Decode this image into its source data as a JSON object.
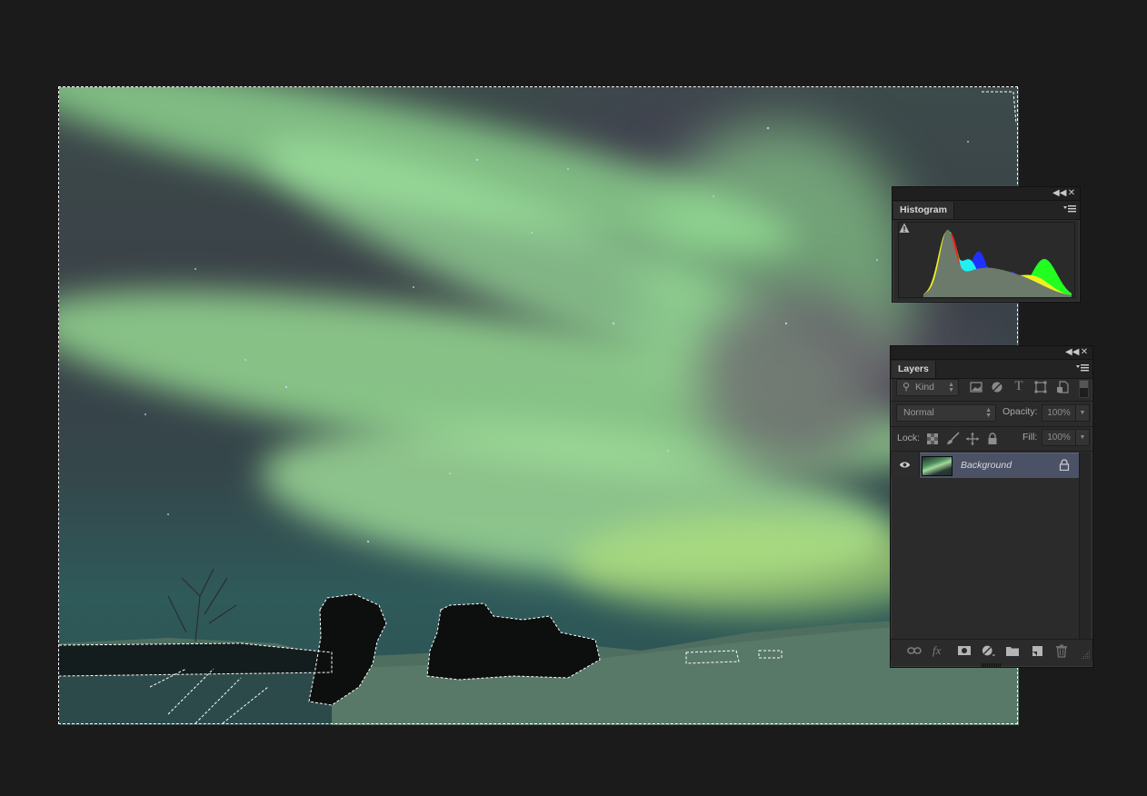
{
  "document": {
    "image_subject": "aurora borealis over snowy landscape with rock formations",
    "selection": "active marching-ants selection",
    "colors": {
      "workspace_bg": "#1b1b1b",
      "aurora_green": "#9fe0a3",
      "sky_dark": "#3a4148",
      "selection": "#ffffff"
    }
  },
  "histogram_panel": {
    "tab_label": "Histogram",
    "collapse_icon": "double-chevron-left-icon",
    "close_icon": "close-icon",
    "menu_icon": "panel-menu-icon",
    "warning_icon": "cached-data-warning-icon",
    "colors": {
      "base": "#6b7a6a",
      "red": "#ff2020",
      "green": "#20ff20",
      "blue": "#2030ff",
      "cyan": "#20f0f0",
      "yellow": "#f0f020",
      "magenta": "#ff20ff"
    }
  },
  "layers_panel": {
    "tab_label": "Layers",
    "filter": {
      "icon": "search-icon",
      "value": "Kind"
    },
    "filter_icons": [
      "pixel-layer-filter-icon",
      "adjustment-layer-filter-icon",
      "type-layer-filter-icon",
      "shape-layer-filter-icon",
      "smart-object-filter-icon"
    ],
    "blend_mode": "Normal",
    "opacity_label": "Opacity:",
    "opacity_value": "100%",
    "lock_label": "Lock:",
    "lock_icons": [
      "lock-transparent-pixels-icon",
      "lock-image-pixels-icon",
      "lock-position-icon",
      "lock-all-icon"
    ],
    "fill_label": "Fill:",
    "fill_value": "100%",
    "layers": [
      {
        "name": "Background",
        "visible": true,
        "locked": true,
        "selected": true
      }
    ],
    "footer_icons": [
      "link-layers-icon",
      "fx-icon",
      "add-mask-icon",
      "adjustment-layer-icon",
      "new-group-icon",
      "new-layer-icon",
      "delete-layer-icon"
    ]
  }
}
